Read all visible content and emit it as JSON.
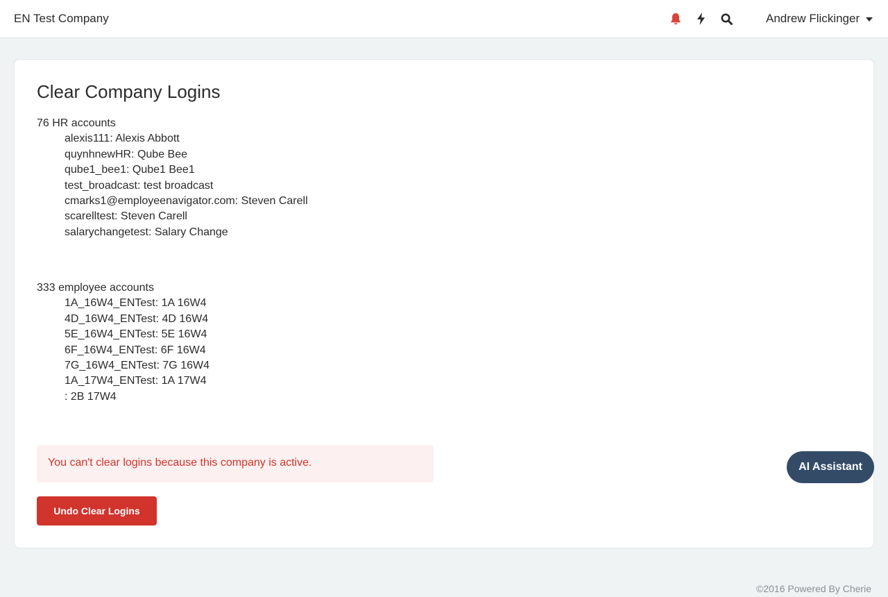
{
  "header": {
    "company_name": "EN Test Company",
    "user_name": "Andrew Flickinger",
    "icons": [
      "bell-icon",
      "lightning-icon",
      "search-icon"
    ]
  },
  "main": {
    "title": "Clear Company Logins",
    "hr_section": {
      "heading": "76 HR accounts",
      "accounts": [
        "alexis111: Alexis Abbott",
        "quynhnewHR: Qube Bee",
        "qube1_bee1: Qube1 Bee1",
        "test_broadcast: test broadcast",
        "cmarks1@employeenavigator.com: Steven Carell",
        "scarelltest: Steven Carell",
        "salarychangetest: Salary Change"
      ]
    },
    "employee_section": {
      "heading": "333 employee accounts",
      "accounts": [
        "1A_16W4_ENTest: 1A 16W4",
        "4D_16W4_ENTest: 4D 16W4",
        "5E_16W4_ENTest: 5E 16W4",
        "6F_16W4_ENTest: 6F 16W4",
        "7G_16W4_ENTest: 7G 16W4",
        "1A_17W4_ENTest: 1A 17W4",
        ": 2B 17W4"
      ]
    },
    "alert_text": "You can't clear logins because this company is active.",
    "undo_button_label": "Undo Clear Logins"
  },
  "ai_assistant_label": "AI Assistant",
  "footer_text": "©2016 Powered By Cherie",
  "colors": {
    "bell": "#d9433b",
    "danger": "#d0342c",
    "alert_bg": "#fdf0f0",
    "assistant_bg": "#344b68",
    "page_bg": "#f0f3f4"
  }
}
